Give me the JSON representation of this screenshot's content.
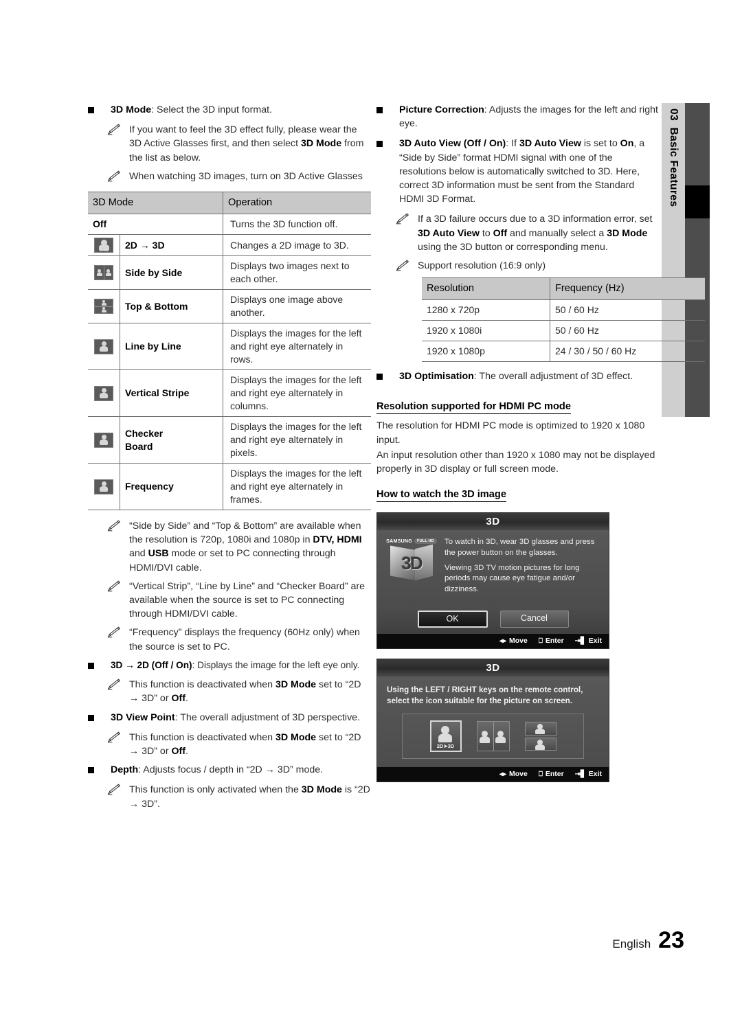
{
  "sidebar": {
    "chapter_number": "03",
    "chapter_title": "Basic Features"
  },
  "footer": {
    "language": "English",
    "page_number": "23"
  },
  "left_column": {
    "items": [
      {
        "type": "bullet",
        "term": "3D Mode",
        "text": ": Select the 3D input format."
      },
      {
        "type": "note",
        "text": "If you want to feel the 3D effect fully, please wear the 3D Active Glasses first, and then select 3D Mode from the list as below."
      },
      {
        "type": "note",
        "text": "When watching 3D images, turn on 3D Active Glasses"
      }
    ],
    "mode_table": {
      "headers": [
        "3D Mode",
        "Operation"
      ],
      "rows": [
        {
          "icon": "none",
          "name": "Off",
          "span": true,
          "operation": "Turns the 3D function off."
        },
        {
          "icon": "2d-to-3d-icon",
          "name": "2D → 3D",
          "operation": "Changes a 2D image to 3D."
        },
        {
          "icon": "side-by-side-icon",
          "name": "Side by Side",
          "operation": "Displays two images next to each other."
        },
        {
          "icon": "top-bottom-icon",
          "name": "Top & Bottom",
          "operation": "Displays one image above another."
        },
        {
          "icon": "line-by-line-icon",
          "name": "Line by Line",
          "operation": "Displays the images for the left and right eye alternately in rows."
        },
        {
          "icon": "vertical-stripe-icon",
          "name": "Vertical Stripe",
          "operation": "Displays the images for the left and right eye alternately in columns."
        },
        {
          "icon": "checker-board-icon",
          "name": "Checker Board",
          "operation": "Displays the images for the left and right eye alternately in pixels."
        },
        {
          "icon": "frequency-icon",
          "name": "Frequency",
          "operation": "Displays the images for the left and right eye alternately in frames."
        }
      ]
    },
    "notes_after_table": [
      "“Side by Side” and “Top & Bottom” are available when the resolution is 720p, 1080i and 1080p in DTV, HDMI and USB mode or set to PC connecting through HDMI/DVI cable.",
      "“Vertical Strip”, “Line by Line” and “Checker Board” are available when the source is set to PC connecting through HDMI/DVI cable.",
      "“Frequency” displays the frequency (60Hz only) when the source is set to PC."
    ],
    "items_bottom": [
      {
        "type": "bullet",
        "term": "3D → 2D (Off / On)",
        "text": ": Displays the image for the left eye only."
      },
      {
        "type": "note",
        "text": "This function is deactivated when 3D Mode set to “2D → 3D” or Off."
      },
      {
        "type": "bullet",
        "term": "3D View Point",
        "text": ": The overall adjustment of 3D perspective."
      },
      {
        "type": "note",
        "text": "This function is deactivated when 3D Mode set to “2D → 3D” or Off."
      },
      {
        "type": "bullet",
        "term": "Depth",
        "text": ": Adjusts focus / depth in “2D → 3D” mode."
      },
      {
        "type": "note",
        "text": "This function is only activated when the 3D Mode is “2D → 3D”."
      }
    ]
  },
  "right_column": {
    "items_top": [
      {
        "type": "bullet",
        "term": "Picture Correction",
        "text": ": Adjusts the images for the left and right eye."
      },
      {
        "type": "bullet",
        "term": "3D Auto View (Off / On)",
        "text": ": If 3D Auto View is set to On, a “Side by Side” format HDMI signal with one of the resolutions below is automatically switched to 3D. Here, correct 3D information must be sent from the Standard HDMI 3D Format."
      },
      {
        "type": "note",
        "text": "If a 3D failure occurs due to a 3D information error, set 3D Auto View to Off and manually select a 3D Mode using the 3D button or corresponding menu."
      },
      {
        "type": "note",
        "text": "Support resolution (16:9 only)"
      }
    ],
    "resolution_table": {
      "headers": [
        "Resolution",
        "Frequency (Hz)"
      ],
      "rows": [
        [
          "1280 x 720p",
          "50 / 60 Hz"
        ],
        [
          "1920 x 1080i",
          "50 / 60 Hz"
        ],
        [
          "1920 x 1080p",
          "24 / 30 / 50 / 60 Hz"
        ]
      ]
    },
    "optimisation": {
      "term": "3D Optimisation",
      "text": ": The overall adjustment of 3D effect."
    },
    "hdmi_section": {
      "heading": "Resolution supported for HDMI PC mode",
      "paragraphs": [
        "The resolution for HDMI PC mode is optimized to 1920 x 1080 input.",
        "An input resolution other than 1920 x 1080 may not be displayed properly in 3D display or full screen mode."
      ]
    },
    "watch_section": {
      "heading": "How to watch the 3D image"
    },
    "dialog_one": {
      "title": "3D",
      "logo_brand": "SAMSUNG",
      "logo_badge": "FULL HD",
      "logo_text": "3D",
      "message_1": "To watch in 3D, wear 3D glasses and press the power button on the glasses.",
      "message_2": "Viewing 3D TV motion pictures for long periods may cause eye fatigue and/or dizziness.",
      "button_ok": "OK",
      "button_cancel": "Cancel",
      "nav": {
        "move": "Move",
        "enter": "Enter",
        "exit": "Exit"
      }
    },
    "dialog_two": {
      "title": "3D",
      "message": "Using the LEFT / RIGHT keys on the remote control, select the icon suitable for the picture on screen.",
      "icon_one_label": "2D➤3D",
      "nav": {
        "move": "Move",
        "enter": "Enter",
        "exit": "Exit"
      }
    }
  }
}
